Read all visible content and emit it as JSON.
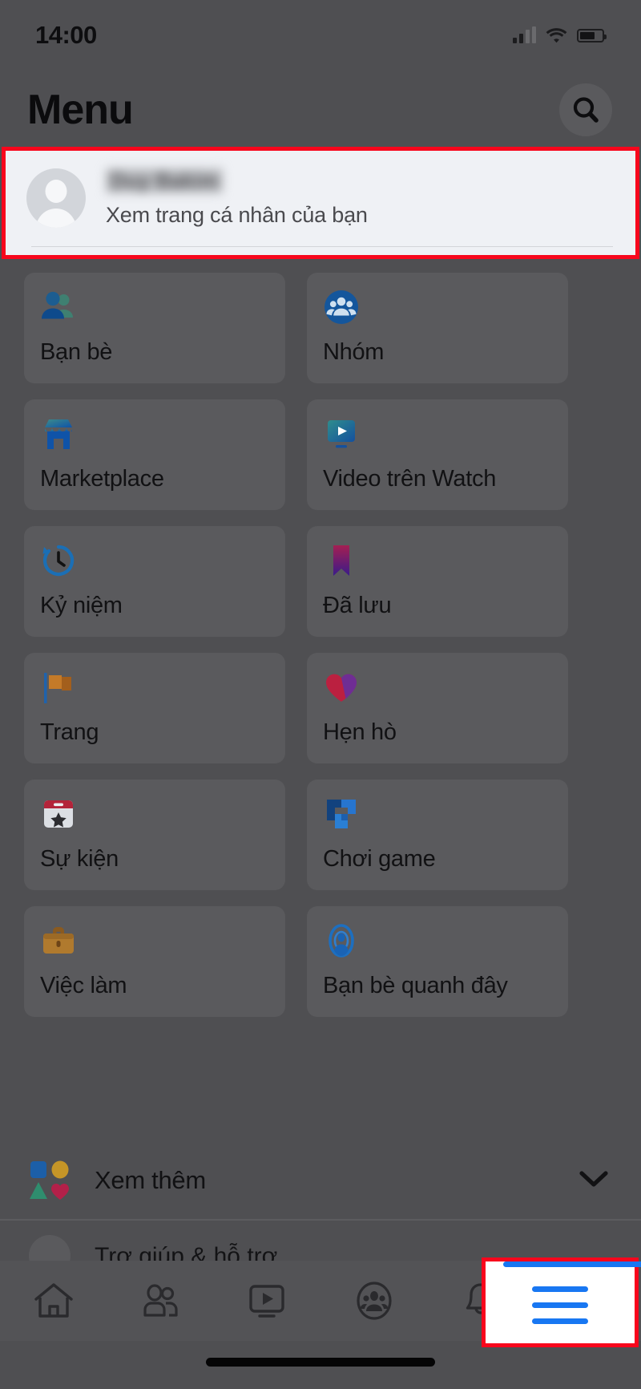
{
  "status_bar": {
    "time": "14:00",
    "signal_icon": "cellular-signal-icon",
    "wifi_icon": "wifi-icon",
    "battery_icon": "battery-icon"
  },
  "header": {
    "title": "Menu",
    "search_icon": "search-icon"
  },
  "profile": {
    "name": "Duy Bakim",
    "subtitle": "Xem trang cá nhân của bạn",
    "avatar_icon": "default-avatar-icon",
    "highlight_color": "#f8061c",
    "card_background": "#eff1f5"
  },
  "menu": {
    "tiles": [
      {
        "label": "Bạn bè",
        "icon": "friends-icon"
      },
      {
        "label": "Nhóm",
        "icon": "groups-icon"
      },
      {
        "label": "Marketplace",
        "icon": "marketplace-storefront-icon"
      },
      {
        "label": "Video trên Watch",
        "icon": "watch-video-icon"
      },
      {
        "label": "Kỷ niệm",
        "icon": "memories-clock-icon"
      },
      {
        "label": "Đã lưu",
        "icon": "saved-bookmark-icon"
      },
      {
        "label": "Trang",
        "icon": "pages-flag-icon"
      },
      {
        "label": "Hẹn hò",
        "icon": "dating-heart-icon"
      },
      {
        "label": "Sự kiện",
        "icon": "events-calendar-icon"
      },
      {
        "label": "Chơi game",
        "icon": "gaming-icon"
      },
      {
        "label": "Việc làm",
        "icon": "jobs-briefcase-icon"
      },
      {
        "label": "Bạn bè quanh đây",
        "icon": "nearby-friends-icon"
      }
    ],
    "see_more": {
      "label": "Xem thêm",
      "icon": "shapes-icon",
      "chevron_icon": "chevron-down-icon"
    },
    "next_row_partial": {
      "label": "Trợ giúp & hỗ trợ"
    }
  },
  "bottom_nav": {
    "items": [
      {
        "icon": "home-icon",
        "active": false
      },
      {
        "icon": "friends-icon",
        "active": false
      },
      {
        "icon": "watch-video-icon",
        "active": false
      },
      {
        "icon": "groups-icon",
        "active": false
      },
      {
        "icon": "notifications-bell-icon",
        "active": false
      },
      {
        "icon": "hamburger-menu-icon",
        "active": true
      }
    ],
    "active_color": "#1877f2",
    "highlight_color": "#f8061c"
  },
  "home_indicator": {
    "visible": true
  }
}
